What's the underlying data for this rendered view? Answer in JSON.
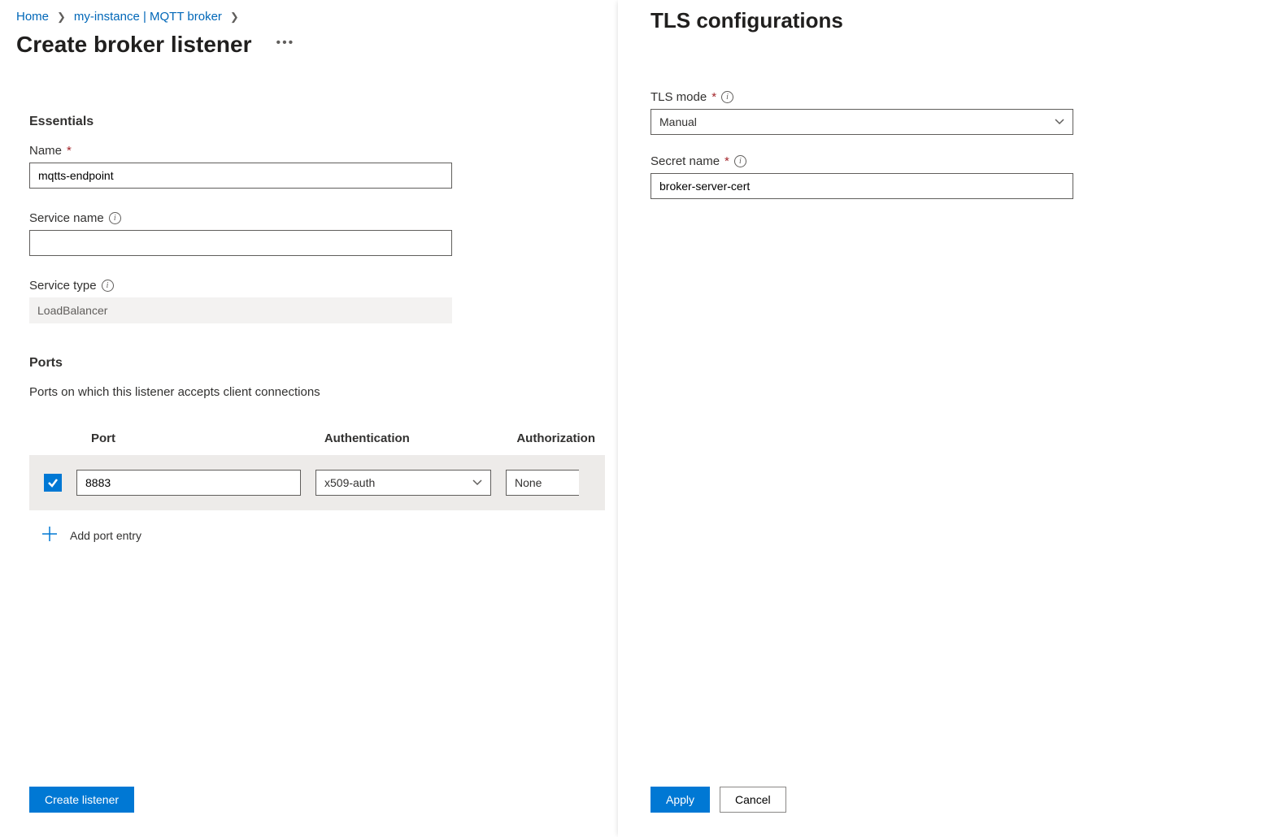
{
  "breadcrumb": {
    "home": "Home",
    "instance": "my-instance | MQTT broker"
  },
  "page_title": "Create broker listener",
  "essentials": {
    "heading": "Essentials",
    "name_label": "Name",
    "name_value": "mqtts-endpoint",
    "service_name_label": "Service name",
    "service_name_value": "",
    "service_type_label": "Service type",
    "service_type_value": "LoadBalancer"
  },
  "ports": {
    "heading": "Ports",
    "description": "Ports on which this listener accepts client connections",
    "headers": {
      "port": "Port",
      "auth": "Authentication",
      "authz": "Authorization"
    },
    "row": {
      "port": "8883",
      "auth": "x509-auth",
      "authz": "None"
    },
    "add_entry": "Add port entry"
  },
  "footer": {
    "create": "Create listener"
  },
  "side": {
    "title": "TLS configurations",
    "tls_mode_label": "TLS mode",
    "tls_mode_value": "Manual",
    "secret_name_label": "Secret name",
    "secret_name_value": "broker-server-cert",
    "apply": "Apply",
    "cancel": "Cancel"
  }
}
